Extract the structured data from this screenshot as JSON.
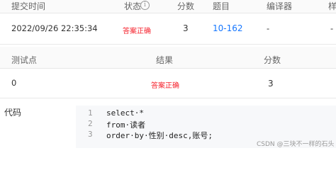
{
  "submission_table": {
    "headers": {
      "time": "提交时间",
      "status": "状态",
      "score": "分数",
      "problem": "题目",
      "compiler": "编译器",
      "extra": "样"
    },
    "row": {
      "time": "2022/09/26 22:35:34",
      "status": "答案正确",
      "score": "3",
      "problem": "10-162",
      "compiler": "-",
      "extra": "-"
    }
  },
  "test_table": {
    "headers": {
      "point": "测试点",
      "result": "结果",
      "score": "分数"
    },
    "row": {
      "point": "0",
      "result": "答案正确",
      "score": "3"
    }
  },
  "code_section": {
    "label": "代码",
    "lines": [
      {
        "no": "1",
        "text": "select·*"
      },
      {
        "no": "2",
        "text": "from·读者"
      },
      {
        "no": "3",
        "text": "order·by·性别·desc,账号;"
      }
    ]
  },
  "watermark": "CSDN @三块不一样的石头",
  "colors": {
    "accepted": "#f5222d",
    "link": "#1677ff"
  }
}
